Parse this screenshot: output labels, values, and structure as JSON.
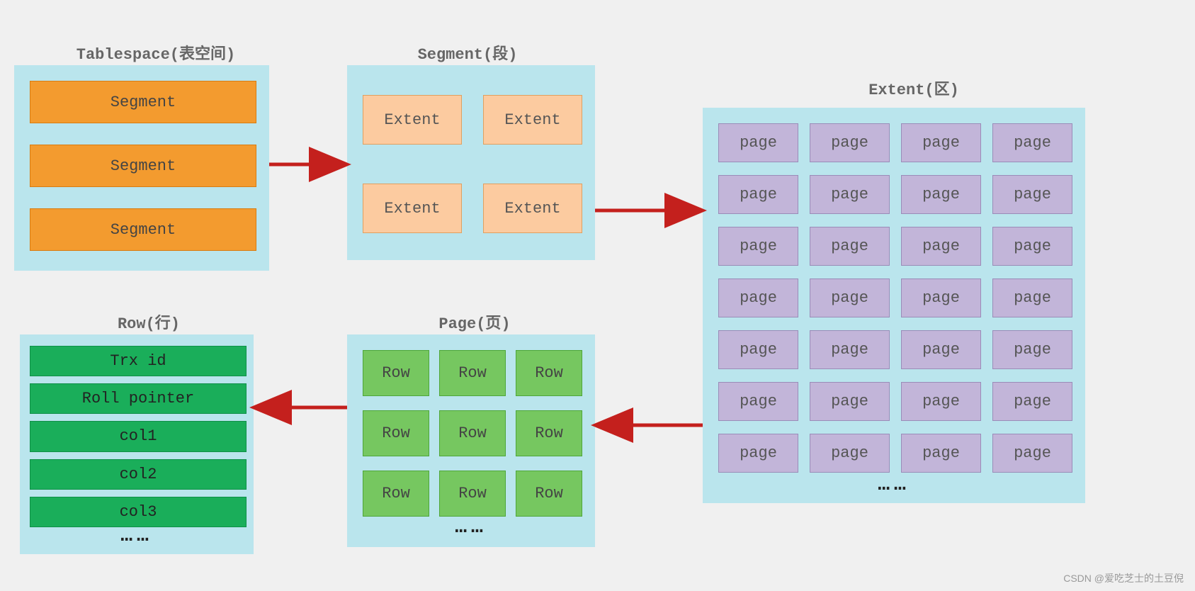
{
  "tablespace": {
    "title": "Tablespace(表空间)",
    "items": [
      "Segment",
      "Segment",
      "Segment"
    ]
  },
  "segment": {
    "title": "Segment(段)",
    "items": [
      "Extent",
      "Extent",
      "Extent",
      "Extent"
    ]
  },
  "extent": {
    "title": "Extent(区)",
    "page_label": "page",
    "rows": 7,
    "cols": 4,
    "ellipsis": "……"
  },
  "page": {
    "title": "Page(页)",
    "row_label": "Row",
    "rows": 3,
    "cols": 3,
    "ellipsis": "……"
  },
  "row": {
    "title": "Row(行)",
    "fields": [
      "Trx id",
      "Roll pointer",
      "col1",
      "col2",
      "col3"
    ],
    "ellipsis": "……"
  },
  "watermark": "CSDN @爱吃芝士的土豆倪"
}
